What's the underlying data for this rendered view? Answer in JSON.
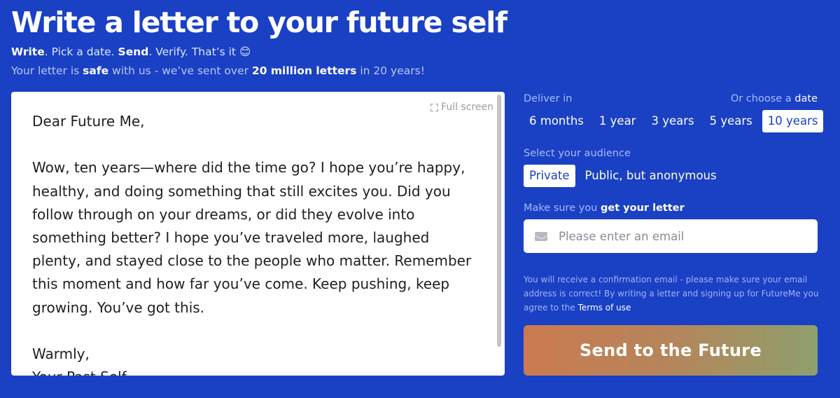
{
  "header": {
    "title": "Write a letter to your future self",
    "steps": {
      "write": "Write",
      "pick": ". Pick a date. ",
      "send": "Send",
      "verify": ". Verify. That’s it ",
      "emoji": "😊"
    },
    "assurance": {
      "part1": "Your letter is ",
      "safe": "safe",
      "part2": " with us - we’ve sent over ",
      "count": "20 million letters",
      "part3": " in 20 years!"
    }
  },
  "editor": {
    "fullscreen_label": "Full screen",
    "fullscreen_icon": "expand-icon",
    "letter_text": "Dear Future Me,\n\nWow, ten years—where did the time go? I hope you’re happy, healthy, and doing something that still excites you. Did you follow through on your dreams, or did they evolve into something better? I hope you’ve traveled more, laughed plenty, and stayed close to the people who matter. Remember this moment and how far you’ve come. Keep pushing, keep growing. You’ve got this.\n\nWarmly,\nYour Past Self"
  },
  "delivery": {
    "label": "Deliver in",
    "choose_prefix": "Or choose a ",
    "choose_link": "date",
    "options": [
      "6 months",
      "1 year",
      "3 years",
      "5 years",
      "10 years"
    ],
    "selected": "10 years"
  },
  "audience": {
    "label": "Select your audience",
    "options": [
      "Private",
      "Public, but anonymous"
    ],
    "selected": "Private"
  },
  "email": {
    "label_prefix": "Make sure you ",
    "label_bold": "get your letter",
    "placeholder": "Please enter an email",
    "value": "",
    "icon": "mail-icon"
  },
  "fineprint": {
    "text": "You will receive a confirmation email - please make sure your email address is correct! By writing a letter and signing up for FutureMe you agree to the ",
    "terms_link": "Terms of use"
  },
  "submit": {
    "label": "Send to the Future"
  },
  "colors": {
    "background": "#1a40c4",
    "button_gradient_start": "#cb7a4e",
    "button_gradient_end": "#8ea06c"
  }
}
